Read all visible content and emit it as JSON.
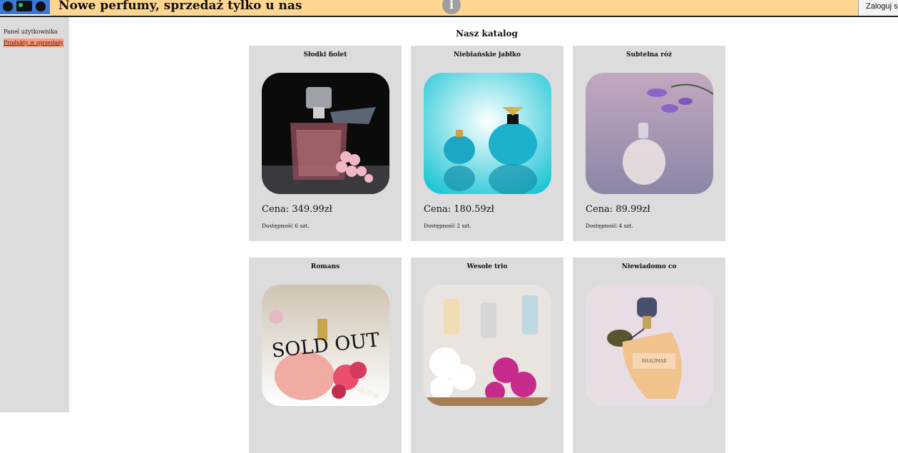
{
  "header": {
    "title": "Nowe perfumy, sprzedaż tylko u nas",
    "info_icon": "i",
    "login_label": "Zaloguj się"
  },
  "sidebar": {
    "panel_label": "Panel użytkownika",
    "items": [
      {
        "label": "Produkty w sprzedaży"
      }
    ]
  },
  "catalog": {
    "title": "Nasz katalog",
    "products": [
      {
        "name": "Słodki fiolet",
        "price": "Cena: 349.99zł",
        "stock": "Dostępność 6 szt."
      },
      {
        "name": "Niebiańskie jabłko",
        "price": "Cena: 180.59zł",
        "stock": "Dostępność 2 szt."
      },
      {
        "name": "Subtelna róż",
        "price": "Cena: 89.99zł",
        "stock": "Dostępność 4 szt."
      },
      {
        "name": "Romans",
        "overlay": "SOLD OUT"
      },
      {
        "name": "Wesołe trio"
      },
      {
        "name": "Niewiadomo co",
        "label_text": "SHALIMAR"
      }
    ]
  },
  "colors": {
    "header_bg": "#ffd592",
    "sidebar_bg": "#dcdcdc",
    "card_bg": "#dcdcdc",
    "active_link_bg": "#ff9a7a"
  }
}
